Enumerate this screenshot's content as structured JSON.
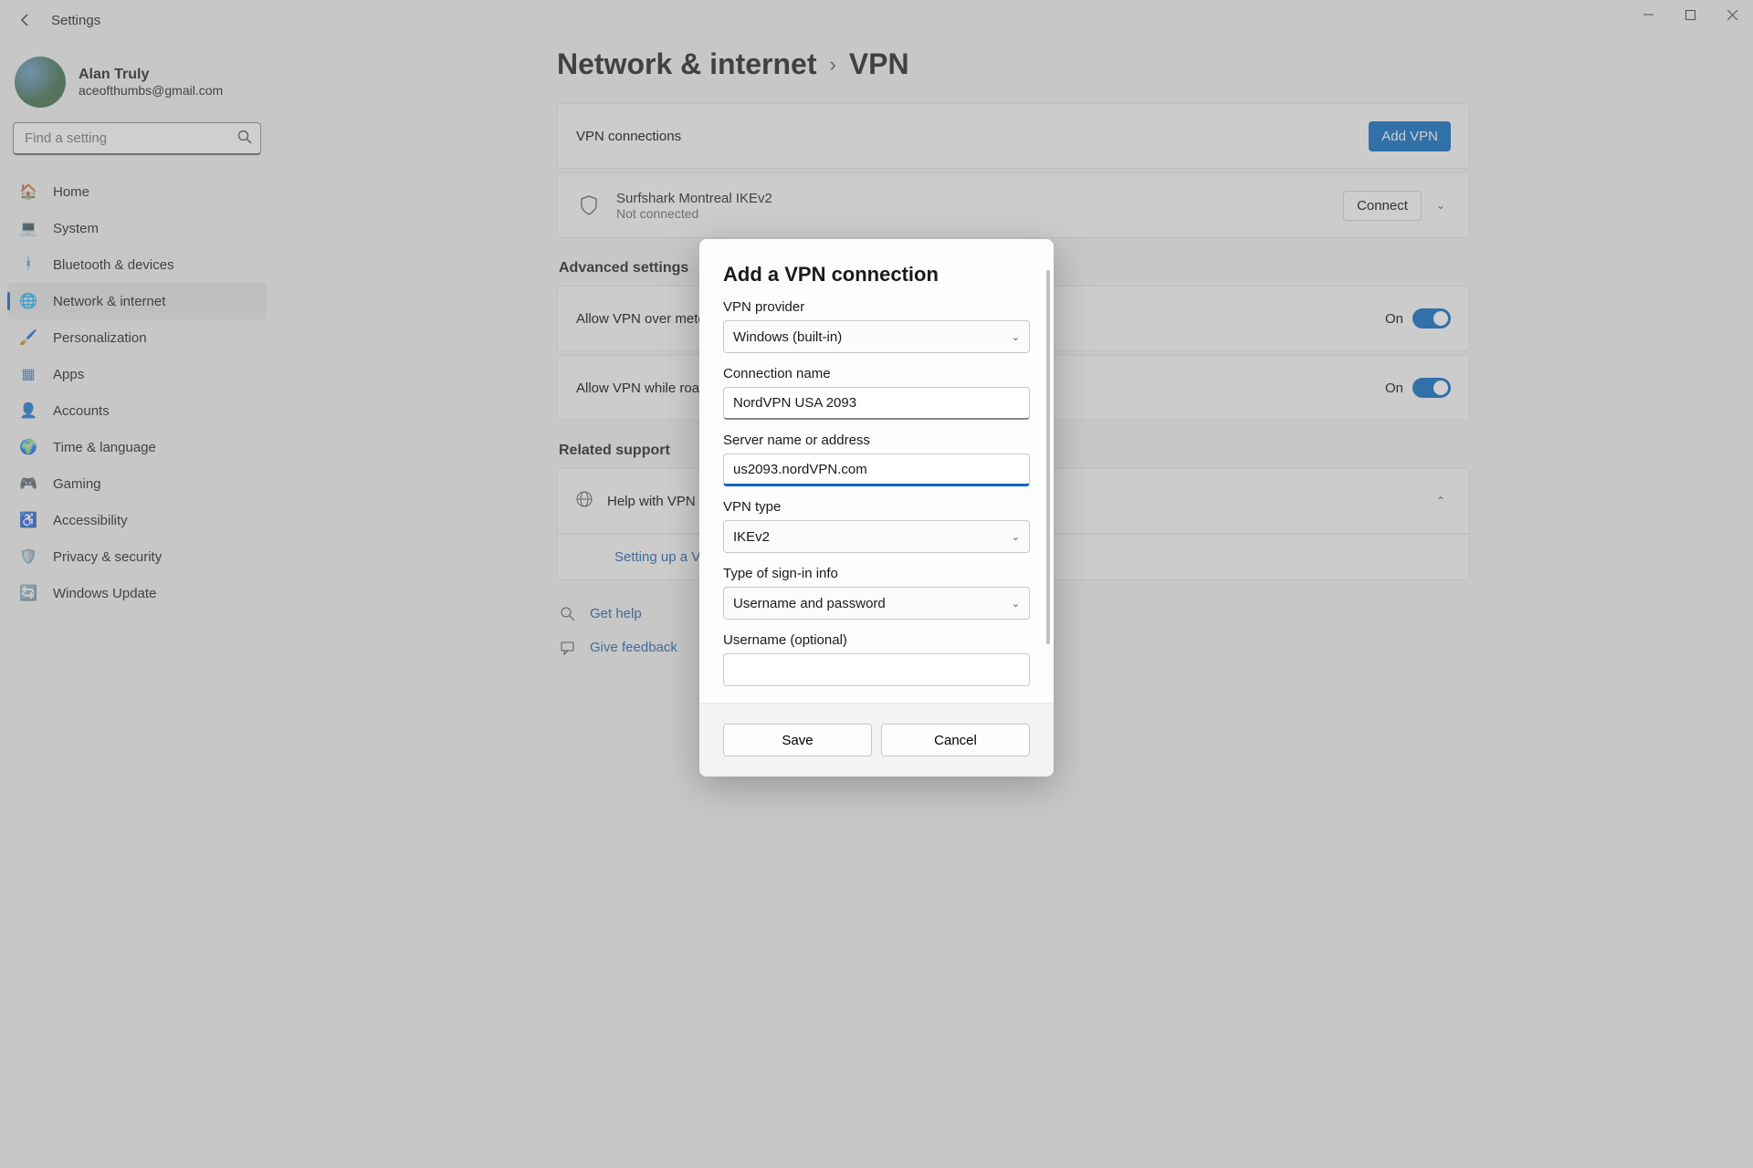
{
  "window": {
    "title": "Settings"
  },
  "user": {
    "name": "Alan Truly",
    "email": "aceofthumbs@gmail.com"
  },
  "search": {
    "placeholder": "Find a setting"
  },
  "nav": {
    "items": [
      {
        "label": "Home",
        "icon": "🏠"
      },
      {
        "label": "System",
        "icon": "💻"
      },
      {
        "label": "Bluetooth & devices",
        "icon": "ᚼ"
      },
      {
        "label": "Network & internet",
        "icon": "🌐"
      },
      {
        "label": "Personalization",
        "icon": "🖌️"
      },
      {
        "label": "Apps",
        "icon": "▦"
      },
      {
        "label": "Accounts",
        "icon": "👤"
      },
      {
        "label": "Time & language",
        "icon": "🌍"
      },
      {
        "label": "Gaming",
        "icon": "🎮"
      },
      {
        "label": "Accessibility",
        "icon": "♿"
      },
      {
        "label": "Privacy & security",
        "icon": "🛡️"
      },
      {
        "label": "Windows Update",
        "icon": "🔄"
      }
    ],
    "selected_index": 3
  },
  "breadcrumb": {
    "parent": "Network & internet",
    "current": "VPN"
  },
  "vpn": {
    "connections_header": "VPN connections",
    "add_button": "Add VPN",
    "connections": [
      {
        "name": "Surfshark Montreal IKEv2",
        "status": "Not connected",
        "action": "Connect"
      }
    ],
    "advanced_header": "Advanced settings",
    "settings": [
      {
        "label": "Allow VPN over metered networks",
        "state": "On"
      },
      {
        "label": "Allow VPN while roaming",
        "state": "On"
      }
    ],
    "related_header": "Related support",
    "help_vpn": "Help with VPN",
    "setting_up_link": "Setting up a VPN",
    "get_help": "Get help",
    "give_feedback": "Give feedback"
  },
  "dialog": {
    "title": "Add a VPN connection",
    "provider_label": "VPN provider",
    "provider_value": "Windows (built-in)",
    "conn_name_label": "Connection name",
    "conn_name_value": "NordVPN USA 2093",
    "server_label": "Server name or address",
    "server_value": "us2093.nordVPN.com",
    "vpn_type_label": "VPN type",
    "vpn_type_value": "IKEv2",
    "signin_label": "Type of sign-in info",
    "signin_value": "Username and password",
    "username_label": "Username (optional)",
    "username_value": "",
    "save": "Save",
    "cancel": "Cancel"
  }
}
